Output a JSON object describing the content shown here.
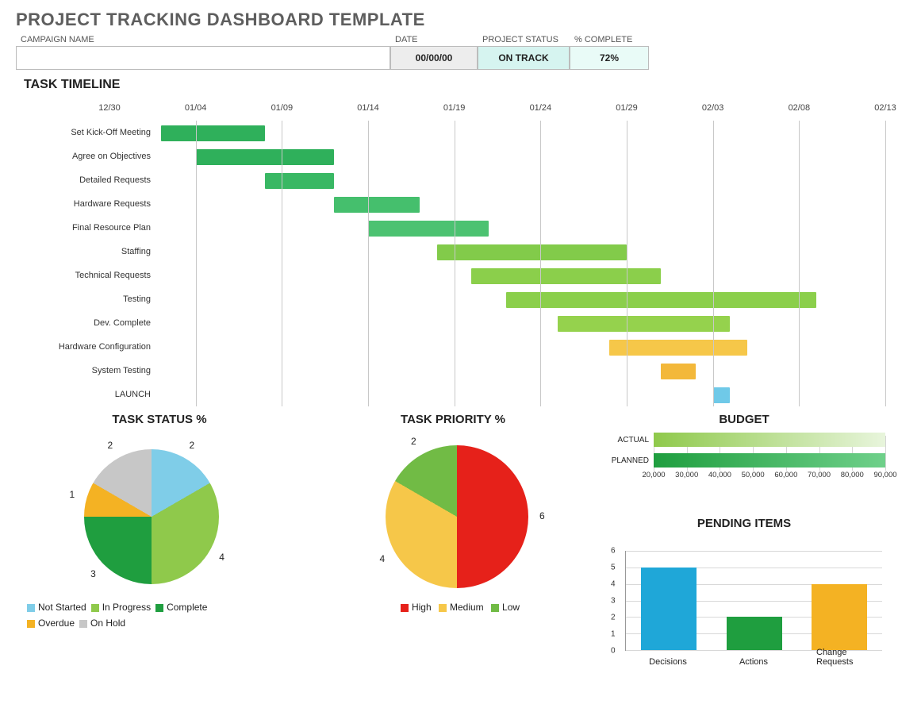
{
  "title": "PROJECT TRACKING DASHBOARD TEMPLATE",
  "header": {
    "labels": {
      "campaign": "CAMPAIGN NAME",
      "date": "DATE",
      "status": "PROJECT  STATUS",
      "pct": "% COMPLETE"
    },
    "values": {
      "campaign": "",
      "date": "00/00/00",
      "status": "ON TRACK",
      "pct": "72%"
    }
  },
  "sections": {
    "timeline": "TASK TIMELINE",
    "status": "TASK STATUS %",
    "priority": "TASK PRIORITY %",
    "budget": "BUDGET",
    "pending": "PENDING ITEMS"
  },
  "chart_data": [
    {
      "id": "timeline",
      "type": "gantt",
      "x_ticks": [
        "12/30",
        "01/04",
        "01/09",
        "01/14",
        "01/19",
        "01/24",
        "01/29",
        "02/03",
        "02/08",
        "02/13"
      ],
      "x_range_days": [
        0,
        45
      ],
      "tasks": [
        {
          "name": "Set Kick-Off Meeting",
          "start": 3,
          "end": 9,
          "color": "#2fb05b"
        },
        {
          "name": "Agree on Objectives",
          "start": 5,
          "end": 13,
          "color": "#2fb05b"
        },
        {
          "name": "Detailed Requests",
          "start": 9,
          "end": 13,
          "color": "#39b864"
        },
        {
          "name": "Hardware Requests",
          "start": 13,
          "end": 18,
          "color": "#45bf6d"
        },
        {
          "name": "Final Resource Plan",
          "start": 15,
          "end": 22,
          "color": "#4cc271"
        },
        {
          "name": "Staffing",
          "start": 19,
          "end": 30,
          "color": "#82cb4a"
        },
        {
          "name": "Technical Requests",
          "start": 21,
          "end": 32,
          "color": "#8bcf4b"
        },
        {
          "name": "Testing",
          "start": 23,
          "end": 41,
          "color": "#8bcf4b"
        },
        {
          "name": "Dev. Complete",
          "start": 26,
          "end": 36,
          "color": "#95d24d"
        },
        {
          "name": "Hardware Configuration",
          "start": 29,
          "end": 37,
          "color": "#f6c749"
        },
        {
          "name": "System Testing",
          "start": 32,
          "end": 34,
          "color": "#f3b83a"
        },
        {
          "name": "LAUNCH",
          "start": 35,
          "end": 36,
          "color": "#6fc9e8"
        }
      ]
    },
    {
      "id": "task_status",
      "type": "pie",
      "title": "TASK STATUS %",
      "series": [
        {
          "name": "Not Started",
          "value": 2,
          "color": "#7fcde8"
        },
        {
          "name": "In Progress",
          "value": 4,
          "color": "#8fc94b"
        },
        {
          "name": "Complete",
          "value": 3,
          "color": "#1f9e3f"
        },
        {
          "name": "Overdue",
          "value": 1,
          "color": "#f4b223"
        },
        {
          "name": "On Hold",
          "value": 2,
          "color": "#c7c7c7"
        }
      ]
    },
    {
      "id": "task_priority",
      "type": "pie",
      "title": "TASK PRIORITY %",
      "series": [
        {
          "name": "High",
          "value": 6,
          "color": "#e6211a"
        },
        {
          "name": "Medium",
          "value": 4,
          "color": "#f6c749"
        },
        {
          "name": "Low",
          "value": 2,
          "color": "#71bb45"
        }
      ]
    },
    {
      "id": "budget",
      "type": "bar_horizontal",
      "title": "BUDGET",
      "x_ticks": [
        20000,
        30000,
        40000,
        50000,
        60000,
        70000,
        80000,
        90000
      ],
      "x_tick_labels": [
        "20,000",
        "30,000",
        "40,000",
        "50,000",
        "60,000",
        "70,000",
        "80,000",
        "90,000"
      ],
      "xlim": [
        20000,
        90000
      ],
      "series": [
        {
          "name": "ACTUAL",
          "value": 90000,
          "color_gradient": [
            "#8fc94b",
            "#e8f5dc"
          ]
        },
        {
          "name": "PLANNED",
          "value": 90000,
          "color_gradient": [
            "#1f9e3f",
            "#6fd08a"
          ]
        }
      ]
    },
    {
      "id": "pending",
      "type": "bar",
      "title": "PENDING ITEMS",
      "ylim": [
        0,
        6
      ],
      "y_ticks": [
        0,
        1,
        2,
        3,
        4,
        5,
        6
      ],
      "categories": [
        "Decisions",
        "Actions",
        "Change Requests"
      ],
      "series": [
        {
          "name": "Decisions",
          "value": 5,
          "color": "#1fa7d8"
        },
        {
          "name": "Actions",
          "value": 2,
          "color": "#1f9e3f"
        },
        {
          "name": "Change Requests",
          "value": 4,
          "color": "#f4b223"
        }
      ]
    }
  ],
  "legends": {
    "status": [
      "Not Started",
      "In Progress",
      "Complete",
      "Overdue",
      "On Hold"
    ],
    "priority": [
      "High",
      "Medium",
      "Low"
    ]
  }
}
